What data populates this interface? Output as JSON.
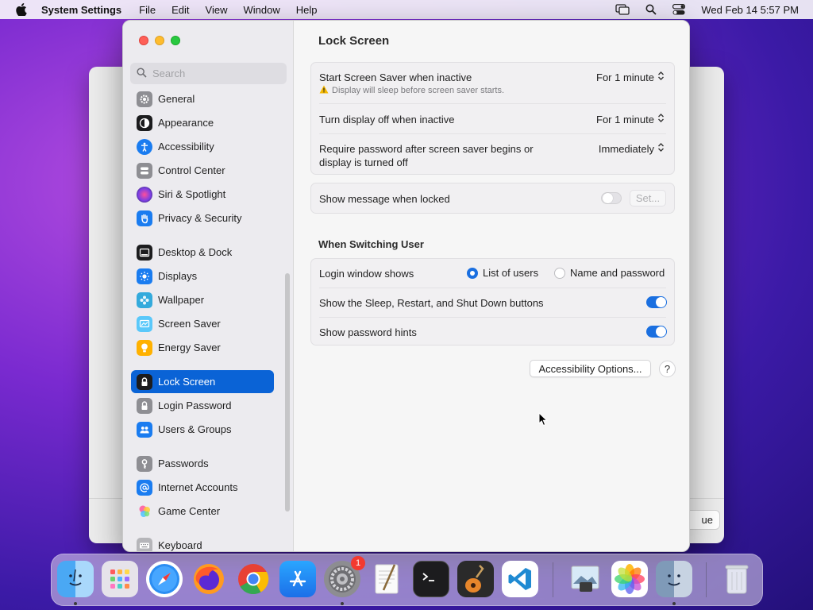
{
  "menubar": {
    "app_name": "System Settings",
    "menus": [
      "File",
      "Edit",
      "View",
      "Window",
      "Help"
    ],
    "clock": "Wed Feb 14  5:57 PM"
  },
  "background_window": {
    "partial_button_label": "ue"
  },
  "sidebar": {
    "search_placeholder": "Search",
    "items": [
      {
        "label": "General",
        "icon": "gear-icon",
        "color": "#8e8e93"
      },
      {
        "label": "Appearance",
        "icon": "appearance-icon",
        "color": "#1c1c1e"
      },
      {
        "label": "Accessibility",
        "icon": "accessibility-icon",
        "color": "#1a7cf0"
      },
      {
        "label": "Control Center",
        "icon": "control-center-icon",
        "color": "#8e8e93"
      },
      {
        "label": "Siri & Spotlight",
        "icon": "siri-icon",
        "color": "#8a3fd6"
      },
      {
        "label": "Privacy & Security",
        "icon": "hand-icon",
        "color": "#1a7cf0"
      },
      {
        "label": "Desktop & Dock",
        "icon": "dock-icon",
        "color": "#1c1c1e"
      },
      {
        "label": "Displays",
        "icon": "sun-icon",
        "color": "#1a7cf0"
      },
      {
        "label": "Wallpaper",
        "icon": "flower-icon",
        "color": "#34aadc"
      },
      {
        "label": "Screen Saver",
        "icon": "screen-saver-icon",
        "color": "#5ac8fa"
      },
      {
        "label": "Energy Saver",
        "icon": "bulb-icon",
        "color": "#ffb100"
      },
      {
        "label": "Lock Screen",
        "icon": "lock-icon",
        "color": "#1c1c1e"
      },
      {
        "label": "Login Password",
        "icon": "lock-icon",
        "color": "#8e8e93"
      },
      {
        "label": "Users & Groups",
        "icon": "users-icon",
        "color": "#1a7cf0"
      },
      {
        "label": "Passwords",
        "icon": "key-icon",
        "color": "#8e8e93"
      },
      {
        "label": "Internet Accounts",
        "icon": "at-icon",
        "color": "#1a7cf0"
      },
      {
        "label": "Game Center",
        "icon": "game-center-icon",
        "color": "#ff5f8f"
      },
      {
        "label": "Keyboard",
        "icon": "keyboard-icon",
        "color": "#8e8e93"
      }
    ],
    "active": "Lock Screen"
  },
  "content": {
    "title": "Lock Screen",
    "screen_saver": {
      "label": "Start Screen Saver when inactive",
      "warning": "Display will sleep before screen saver starts.",
      "value": "For 1 minute"
    },
    "display_off": {
      "label": "Turn display off when inactive",
      "value": "For 1 minute"
    },
    "require_password": {
      "label_line1": "Require password after screen saver begins or",
      "label_line2": "display is turned off",
      "value": "Immediately"
    },
    "show_message": {
      "label": "Show message when locked",
      "button": "Set...",
      "enabled": false
    },
    "switching_user": {
      "heading": "When Switching User",
      "login_window": {
        "label": "Login window shows",
        "option1": "List of users",
        "option2": "Name and password",
        "selected": "List of users"
      },
      "sleep_restart": {
        "label": "Show the Sleep, Restart, and Shut Down buttons",
        "enabled": true
      },
      "password_hints": {
        "label": "Show password hints",
        "enabled": true
      }
    },
    "accessibility_button": "Accessibility Options...",
    "help_label": "?"
  },
  "dock": {
    "apps": [
      "Finder",
      "Launchpad",
      "Safari",
      "Firefox",
      "Chrome",
      "App Store",
      "System Settings",
      "TextEdit",
      "Terminal",
      "GarageBand",
      "Visual Studio Code",
      "Preview",
      "Photos",
      "Finder 2",
      "Trash"
    ],
    "system_settings_badge": "1"
  }
}
